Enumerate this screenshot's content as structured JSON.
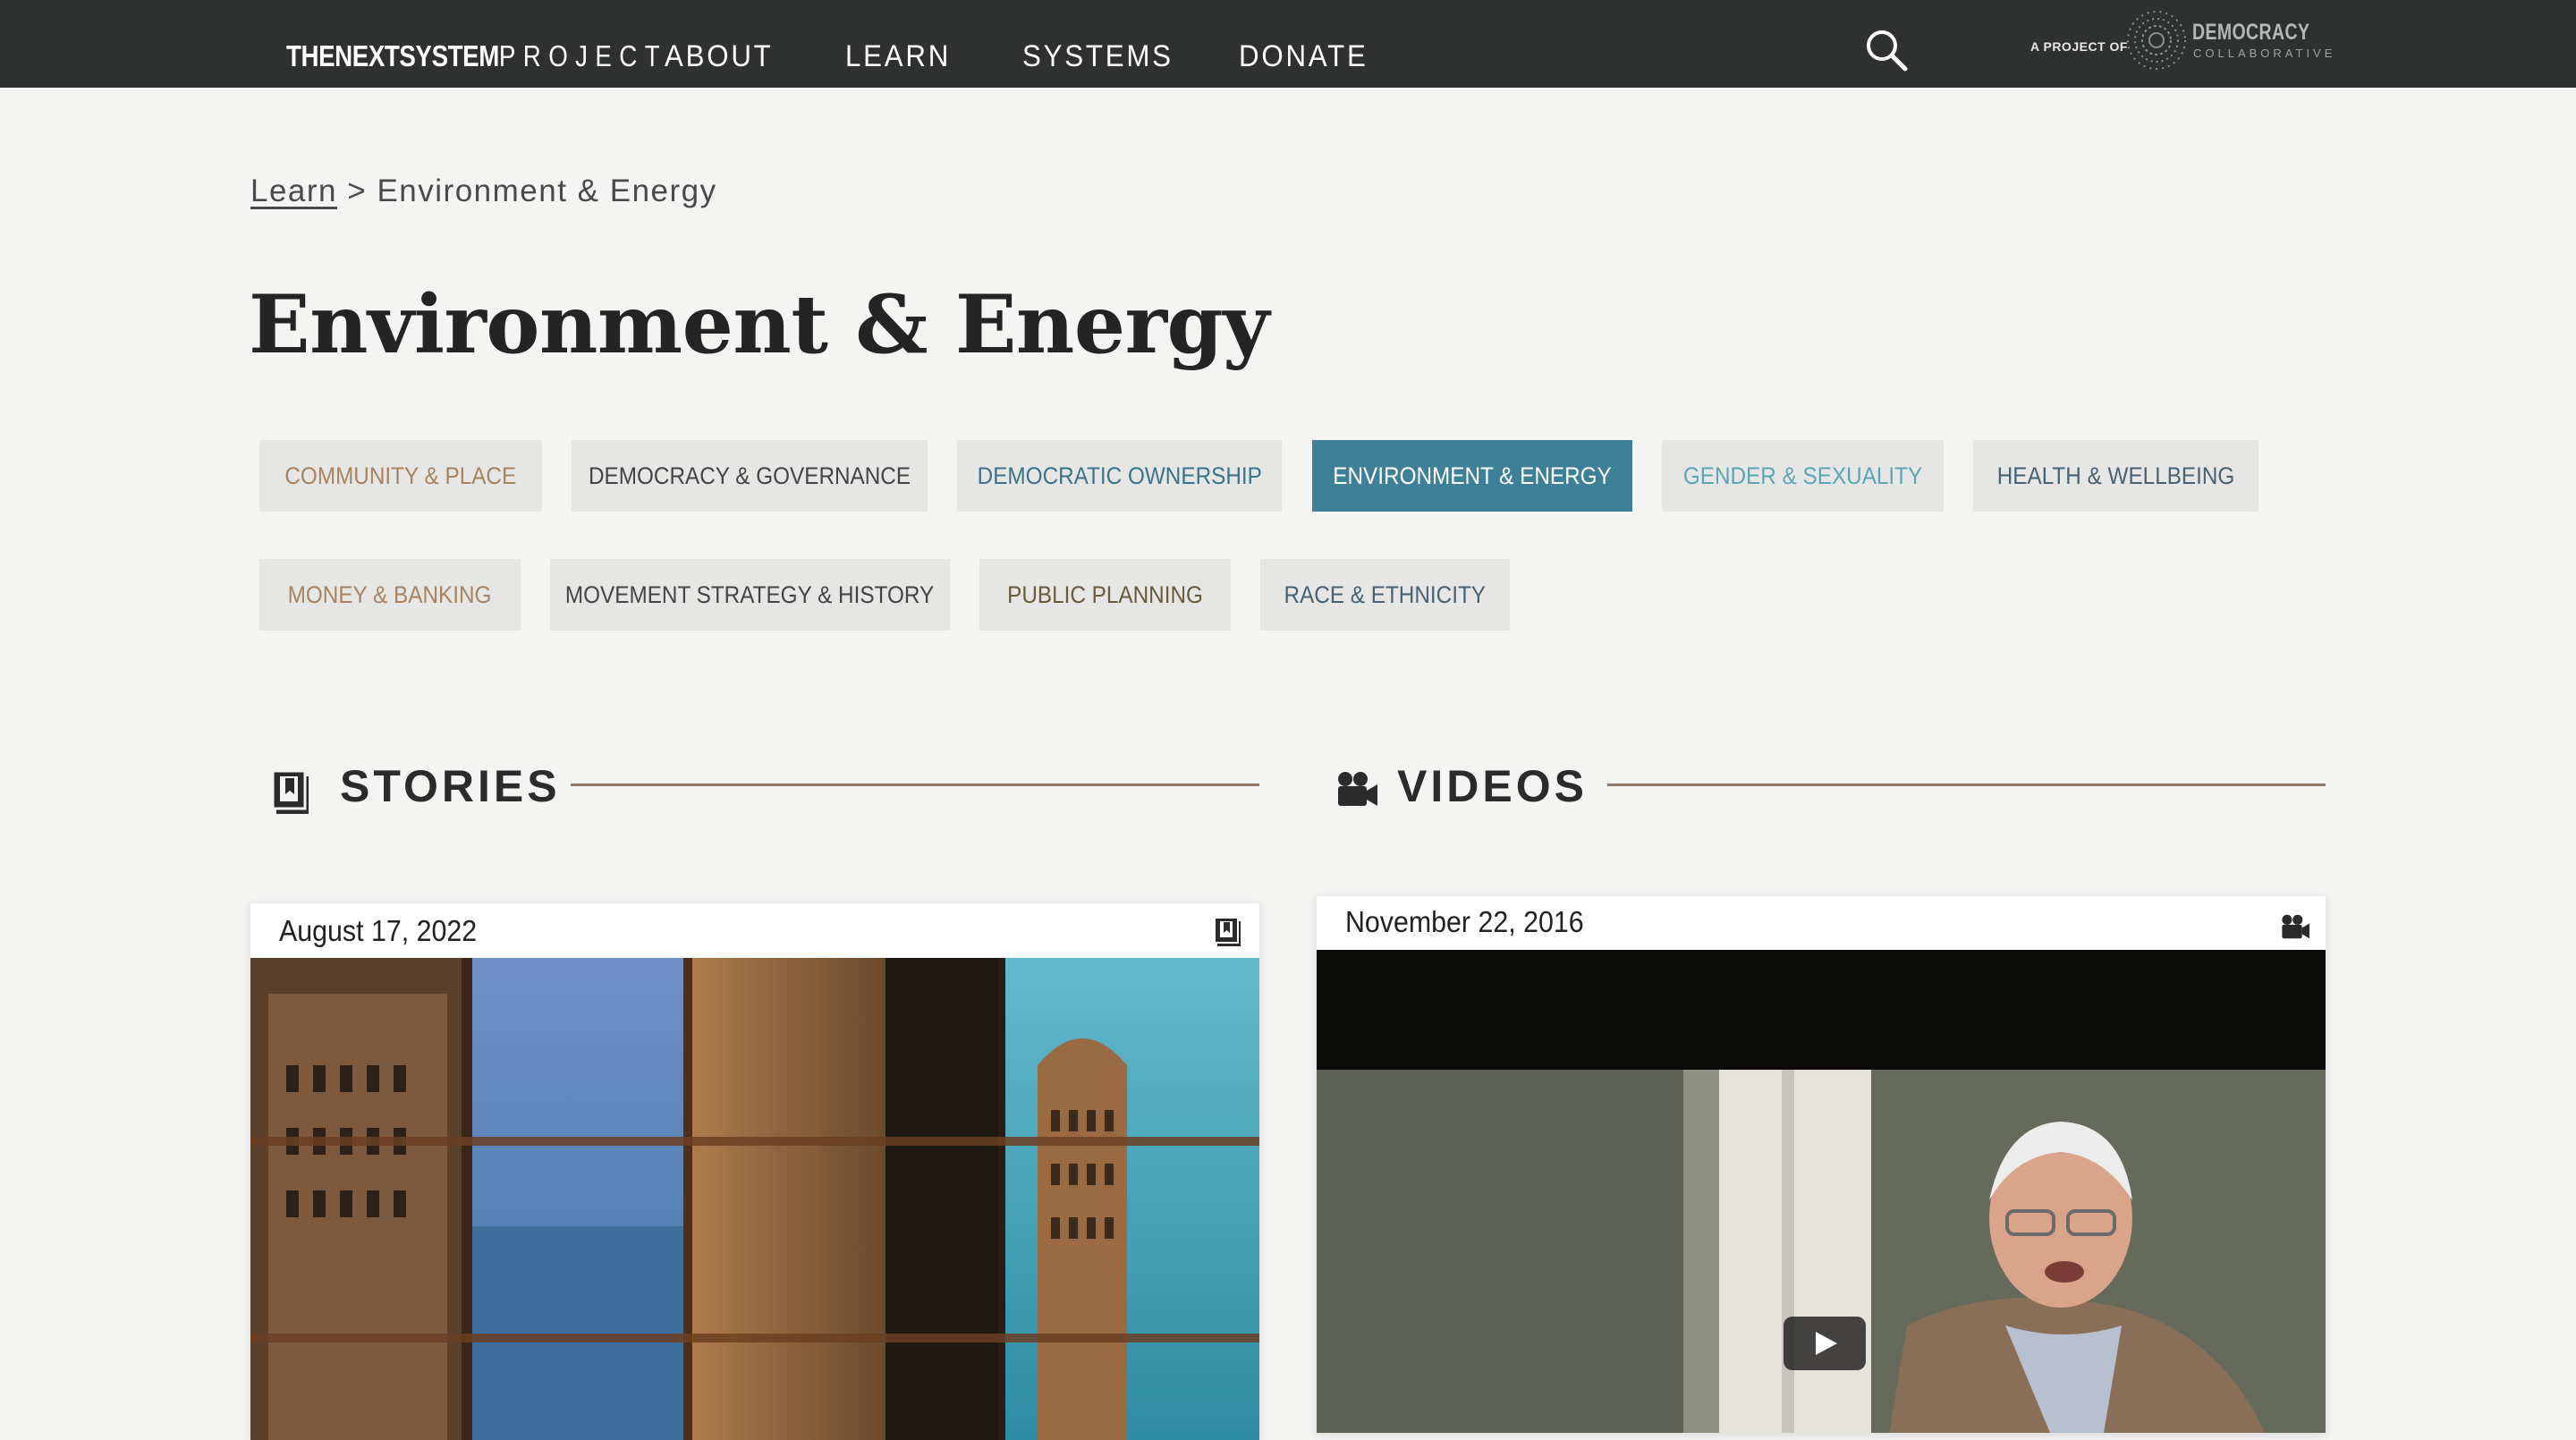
{
  "header": {
    "brand_main": "THENEXTSYSTEM",
    "brand_project": "PROJECT",
    "nav": [
      "ABOUT",
      "LEARN",
      "SYSTEMS",
      "DONATE"
    ],
    "project_of": "A PROJECT OF",
    "partner_name": "DEMOCRACY",
    "partner_sub": "COLLABORATIVE"
  },
  "breadcrumb": {
    "parent": "Learn",
    "separator": ">",
    "current": "Environment & Energy"
  },
  "page": {
    "title": "Environment & Energy"
  },
  "topics": [
    {
      "label": "COMMUNITY & PLACE",
      "color": "#a8835f"
    },
    {
      "label": "DEMOCRACY & GOVERNANCE",
      "color": "#444444"
    },
    {
      "label": "DEMOCRATIC OWNERSHIP",
      "color": "#3b738a"
    },
    {
      "label": "ENVIRONMENT & ENERGY",
      "color": "#ffffff",
      "active": true
    },
    {
      "label": "GENDER & SEXUALITY",
      "color": "#5ea5b4"
    },
    {
      "label": "HEALTH & WELLBEING",
      "color": "#466273"
    },
    {
      "label": "MONEY & BANKING",
      "color": "#a8835f"
    },
    {
      "label": "MOVEMENT STRATEGY & HISTORY",
      "color": "#444444"
    },
    {
      "label": "PUBLIC PLANNING",
      "color": "#6a5a3c"
    },
    {
      "label": "RACE & ETHNICITY",
      "color": "#466273"
    }
  ],
  "sections": {
    "stories": {
      "title": "STORIES",
      "icon": "book-icon"
    },
    "videos": {
      "title": "VIDEOS",
      "icon": "video-camera-icon"
    }
  },
  "story_card": {
    "date": "August 17, 2022",
    "icon": "book-icon"
  },
  "video_card": {
    "date": "November 22, 2016",
    "icon": "video-camera-icon"
  },
  "colors": {
    "nav_bg": "#2f3130",
    "page_bg": "#f4f4f3",
    "active_topic": "#3e8097",
    "section_rule": "#8d7a66"
  }
}
